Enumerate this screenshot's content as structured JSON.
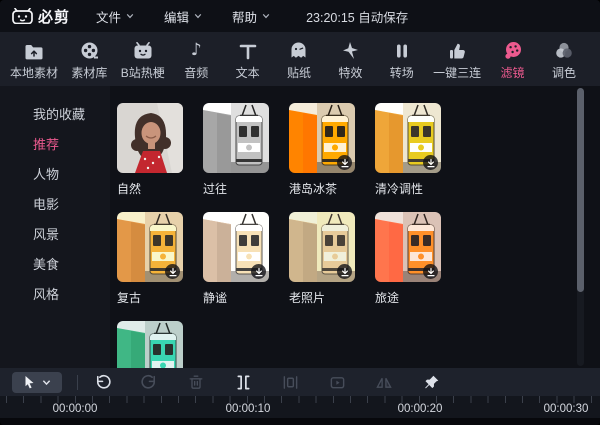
{
  "app": {
    "name": "必剪",
    "autosave_status": "23:20:15 自动保存"
  },
  "colors": {
    "accent": "#ec5a8f",
    "background": "#0f1117",
    "tabbar_bg": "#1c1f28"
  },
  "menubar": {
    "items": [
      {
        "label": "文件"
      },
      {
        "label": "编辑"
      },
      {
        "label": "帮助"
      }
    ]
  },
  "tabbar": {
    "tabs": [
      {
        "label": "本地素材",
        "icon": "folder-upload-icon",
        "active": false
      },
      {
        "label": "素材库",
        "icon": "film-reel-icon",
        "active": false
      },
      {
        "label": "B站热梗",
        "icon": "tv-icon",
        "active": false
      },
      {
        "label": "音频",
        "icon": "music-note-icon",
        "active": false
      },
      {
        "label": "文本",
        "icon": "text-icon",
        "active": false
      },
      {
        "label": "贴纸",
        "icon": "sticker-ghost-icon",
        "active": false
      },
      {
        "label": "特效",
        "icon": "magic-star-icon",
        "active": false
      },
      {
        "label": "转场",
        "icon": "transition-icon",
        "active": false
      },
      {
        "label": "一键三连",
        "icon": "thumbs-up-icon",
        "active": false
      },
      {
        "label": "滤镜",
        "icon": "palette-icon",
        "active": true
      },
      {
        "label": "调色",
        "icon": "color-circles-icon",
        "active": false
      }
    ]
  },
  "sidebar": {
    "items": [
      {
        "label": "我的收藏",
        "active": false
      },
      {
        "label": "推荐",
        "active": true
      },
      {
        "label": "人物",
        "active": false
      },
      {
        "label": "电影",
        "active": false
      },
      {
        "label": "风景",
        "active": false
      },
      {
        "label": "美食",
        "active": false
      },
      {
        "label": "风格",
        "active": false
      }
    ]
  },
  "filters": {
    "items": [
      {
        "label": "自然",
        "downloadable": false
      },
      {
        "label": "过往",
        "downloadable": false
      },
      {
        "label": "港岛冰茶",
        "downloadable": true
      },
      {
        "label": "清冷调性",
        "downloadable": true
      },
      {
        "label": "复古",
        "downloadable": true
      },
      {
        "label": "静谧",
        "downloadable": true
      },
      {
        "label": "老照片",
        "downloadable": true
      },
      {
        "label": "旅途",
        "downloadable": true
      },
      {
        "label": "",
        "downloadable": false,
        "partially_visible": true
      }
    ]
  },
  "toolbar": {
    "buttons": [
      {
        "icon": "cursor-select-icon",
        "enabled": true
      },
      {
        "icon": "undo-icon",
        "enabled": true
      },
      {
        "icon": "redo-icon",
        "enabled": false
      },
      {
        "icon": "trash-icon",
        "enabled": false
      },
      {
        "icon": "split-icon",
        "enabled": true
      },
      {
        "icon": "freeze-frame-icon",
        "enabled": false
      },
      {
        "icon": "record-icon",
        "enabled": false
      },
      {
        "icon": "mirror-icon",
        "enabled": false
      },
      {
        "icon": "pin-icon",
        "enabled": true
      }
    ]
  },
  "timeline": {
    "ticks": [
      "00:00:00",
      "00:00:10",
      "00:00:20",
      "00:00:30"
    ]
  }
}
